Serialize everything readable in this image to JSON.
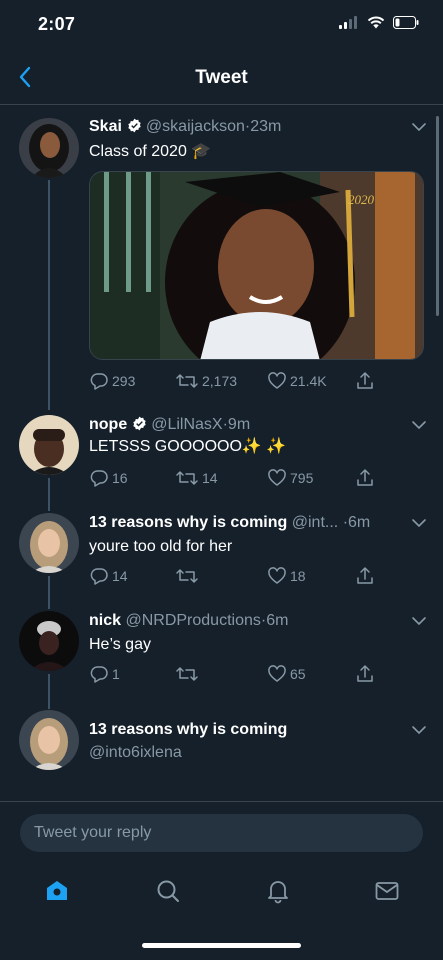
{
  "status": {
    "time": "2:07"
  },
  "nav": {
    "title": "Tweet"
  },
  "tweets": [
    {
      "name": "Skai",
      "verified": true,
      "handle": "@skaijackson",
      "time": "23m",
      "text": "Class of 2020 🎓",
      "has_image": true,
      "image_badge": "2020",
      "replies": "293",
      "retweets": "2,173",
      "likes": "21.4K"
    },
    {
      "name": "nope",
      "verified": true,
      "handle": "@LilNasX",
      "time": "9m",
      "text": "LETSSS GOOOOOO✨ ✨",
      "replies": "16",
      "retweets": "14",
      "likes": "795"
    },
    {
      "name": "13 reasons why is coming",
      "handle": "@int...",
      "time": "6m",
      "text": "youre too old for her",
      "replies": "14",
      "retweets": "",
      "likes": "18"
    },
    {
      "name": "nick",
      "handle": "@NRDProductions",
      "time": "6m",
      "text": "He’s gay",
      "replies": "1",
      "retweets": "",
      "likes": "65"
    },
    {
      "name": "13 reasons why is coming",
      "handle": "@into6ixlena"
    }
  ],
  "separator": "·",
  "reply": {
    "placeholder": "Tweet your reply"
  },
  "colors": {
    "background": "#15202b",
    "accent": "#1da1f2",
    "muted": "#8899a6",
    "divider": "#38444d"
  },
  "icons": {
    "back": "chevron-left-icon",
    "home": "home-icon",
    "search": "search-icon",
    "notifications": "bell-icon",
    "messages": "envelope-icon"
  }
}
